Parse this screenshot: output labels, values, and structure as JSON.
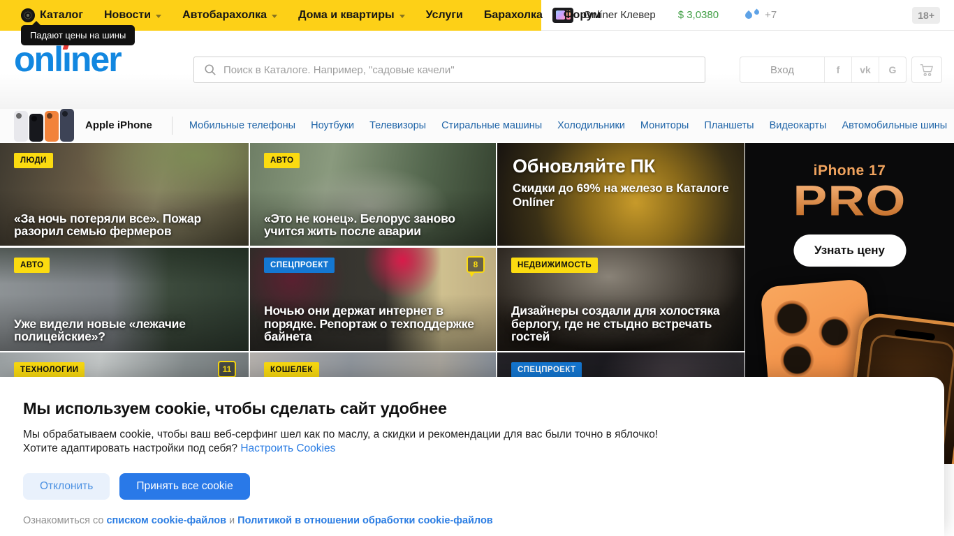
{
  "topbar": {
    "items": [
      {
        "label": "Каталог"
      },
      {
        "label": "Новости"
      },
      {
        "label": "Автобарахолка"
      },
      {
        "label": "Дома и квартиры"
      },
      {
        "label": "Услуги"
      },
      {
        "label": "Барахолка"
      },
      {
        "label": "Форум"
      }
    ],
    "tooltip": "Падают цены на шины",
    "widget_label": "Onlíner Клевер",
    "currency": "$ 3,0380",
    "weather_temp": "+7",
    "age_badge": "18+"
  },
  "logo": {
    "pre": "onl",
    "i": "ı",
    "post": "ner"
  },
  "header": {
    "search_placeholder": "Поиск в Каталоге. Например, \"садовые качели\"",
    "login_label": "Вход",
    "social": [
      "f",
      "vk",
      "G"
    ]
  },
  "catalog_nav": {
    "featured_label": "Apple iPhone",
    "links": [
      "Мобильные телефоны",
      "Ноутбуки",
      "Телевизоры",
      "Стиральные машины",
      "Холодильники",
      "Мониторы",
      "Планшеты",
      "Видеокарты",
      "Автомобильные шины"
    ]
  },
  "tiles": [
    {
      "badge": "ЛЮДИ",
      "title": "«За ночь потеряли все». Пожар разорил семью фермеров"
    },
    {
      "badge": "АВТО",
      "title": "«Это не конец». Белорус заново учится жить после аварии"
    },
    {
      "promo_title": "Обновляйте ПК",
      "promo_subtitle": "Скидки до 69% на железо в Каталоге Onlíner"
    },
    {
      "badge": "АВТО",
      "title": "Уже видели новые «лежачие полицейские»?"
    },
    {
      "badge": "СПЕЦПРОЕКТ",
      "title": "Ночью они держат интернет в порядке. Репортаж о техподдержке байнета",
      "comments": "8"
    },
    {
      "badge": "НЕДВИЖИМОСТЬ",
      "title": "Дизайнеры создали для холостяка берлогу, где не стыдно встречать гостей"
    },
    {
      "badge": "ТЕХНОЛОГИИ",
      "comments": "11"
    },
    {
      "badge": "КОШЕЛЕК"
    },
    {
      "badge": "СПЕЦПРОЕКТ"
    }
  ],
  "ad": {
    "brand": "iPhone 17",
    "title": "PRO",
    "button_label": "Узнать цену"
  },
  "cookie": {
    "title": "Мы используем cookie, чтобы сделать сайт удобнее",
    "body_line1": "Мы обрабатываем cookie, чтобы ваш веб-серфинг шел как по маслу, а скидки и рекомендации для вас были точно в яблочко!",
    "body_line2_prefix": "Хотите адаптировать настройки под себя?",
    "body_line2_link": "Настроить Cookies",
    "decline_label": "Отклонить",
    "accept_label": "Принять все cookie",
    "footer_prefix": "Ознакомиться со",
    "footer_link1": "списком cookie-файлов",
    "footer_and": "и",
    "footer_link2": "Политикой в отношении обработки cookie-файлов"
  }
}
